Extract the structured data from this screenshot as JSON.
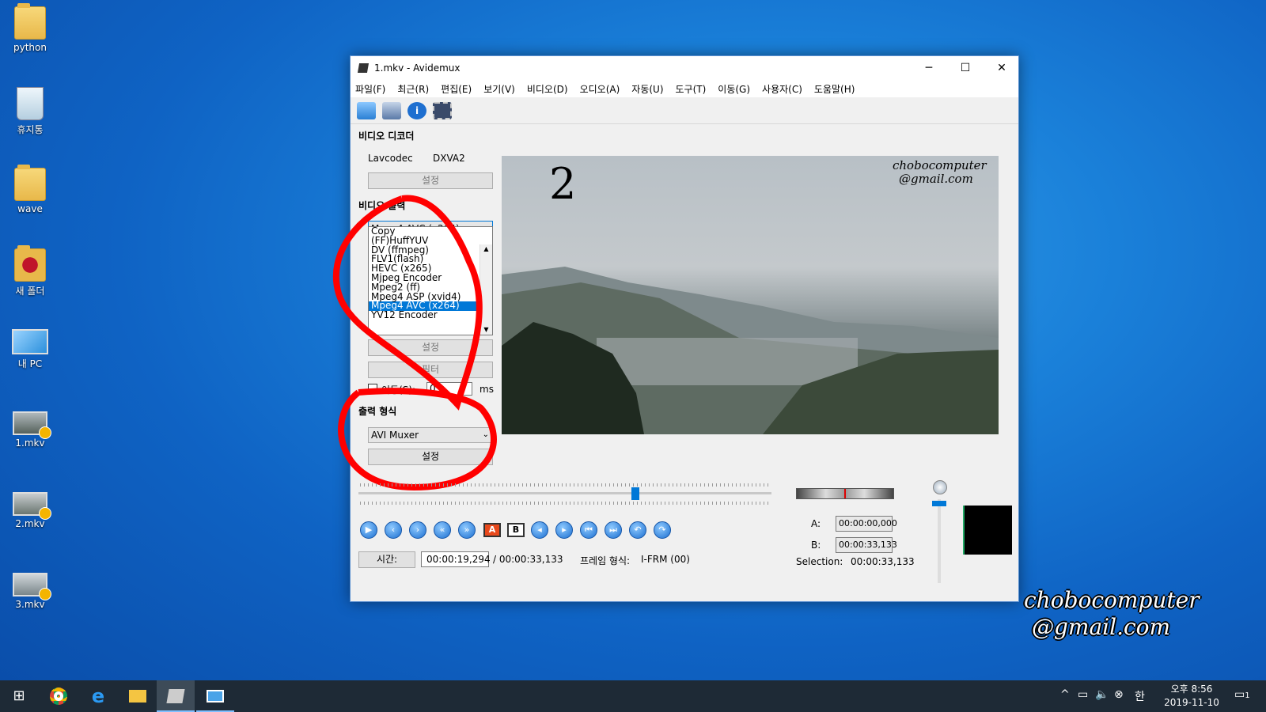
{
  "desktop": {
    "icons": [
      {
        "label": "python",
        "kind": "folder-icon"
      },
      {
        "label": "휴지통",
        "kind": "recycle-bin-icon"
      },
      {
        "label": "wave",
        "kind": "folder-icon"
      },
      {
        "label": "새 폴더",
        "kind": "folder-icon"
      },
      {
        "label": "내 PC",
        "kind": "computer-icon"
      },
      {
        "label": "1.mkv",
        "kind": "video-file-icon"
      },
      {
        "label": "2.mkv",
        "kind": "video-file-icon"
      },
      {
        "label": "3.mkv",
        "kind": "video-file-icon"
      }
    ],
    "watermark_line1": "chobocomputer",
    "watermark_line2": "@gmail.com"
  },
  "window": {
    "title": "1.mkv - Avidemux",
    "controls": {
      "minimize": "─",
      "maximize": "☐",
      "close": "✕"
    },
    "menu": [
      "파일(F)",
      "최근(R)",
      "편집(E)",
      "보기(V)",
      "비디오(D)",
      "오디오(A)",
      "자동(U)",
      "도구(T)",
      "이동(G)",
      "사용자(C)",
      "도움말(H)"
    ],
    "toolbar": [
      "open-icon",
      "save-icon",
      "info-icon",
      "film-icon"
    ],
    "video_decoder": {
      "heading": "비디오 디코더",
      "lavcodec": "Lavcodec",
      "dxva": "DXVA2",
      "settings": "설정"
    },
    "video_output": {
      "heading": "비디오 출력",
      "selected": "Mpeg4 AVC (x264)",
      "options": [
        "Copy",
        "(FF)HuffYUV",
        "DV (ffmpeg)",
        "FLV1(flash)",
        "HEVC (x265)",
        "Mjpeg Encoder",
        "Mpeg2 (ff)",
        "Mpeg4 ASP (xvid4)",
        "Mpeg4 AVC (x264)",
        "YV12 Encoder"
      ],
      "highlighted_index": 8,
      "settings": "설정",
      "filter": "필터",
      "shift_label": "이동(S):",
      "shift_value": "0",
      "shift_unit": "ms"
    },
    "output_format": {
      "heading": "출력 형식",
      "selected": "AVI Muxer",
      "settings": "설정"
    },
    "video_overlay": {
      "number": "2",
      "line1": "chobocomputer",
      "line2": "@gmail.com"
    },
    "timeline": {
      "position_fraction": 0.67
    },
    "transport_buttons": [
      "play-icon",
      "prev-frame-icon",
      "next-frame-icon",
      "rewind-icon",
      "fast-forward-icon",
      "marker-a-icon",
      "marker-b-icon",
      "prev-black-icon",
      "next-black-icon",
      "first-frame-icon",
      "last-frame-icon",
      "prev-keyframe-icon",
      "next-keyframe-icon"
    ],
    "marker_a_label": "A",
    "marker_b_label": "B",
    "time": {
      "label": "시간:",
      "current": "00:00:19,294",
      "total": "/ 00:00:33,133",
      "frame_type_label": "프레임 형식:",
      "frame_type": "I-FRM (00)"
    },
    "selection": {
      "a_label": "A:",
      "a_value": "00:00:00,000",
      "b_label": "B:",
      "b_value": "00:00:33,133",
      "selection_label": "Selection:",
      "selection_value": "00:00:33,133"
    }
  },
  "taskbar": {
    "apps": [
      "start-icon",
      "chrome-icon",
      "edge-icon",
      "file-explorer-icon",
      "avidemux-icon",
      "screen-capture-icon"
    ],
    "ime": "한",
    "clock_time": "오후 8:56",
    "clock_date": "2019-11-10",
    "notification_count": "1"
  },
  "colors": {
    "annotation_red": "#ff0000",
    "accent": "#0078d7"
  }
}
